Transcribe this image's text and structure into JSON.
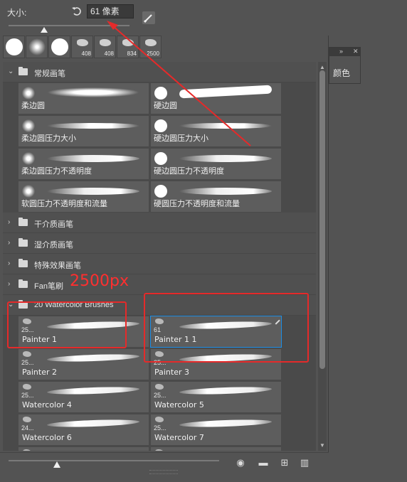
{
  "size_row": {
    "label": "大小:",
    "value": "61 像素"
  },
  "recent_presets": [
    {
      "num": ""
    },
    {
      "num": ""
    },
    {
      "num": ""
    },
    {
      "num": "408"
    },
    {
      "num": "408"
    },
    {
      "num": "834"
    },
    {
      "num": "2500"
    }
  ],
  "groups": {
    "general": {
      "name": "常规画笔"
    },
    "dry": {
      "name": "干介质画笔"
    },
    "wet": {
      "name": "湿介质画笔"
    },
    "special": {
      "name": "特殊效果画笔"
    },
    "fan": {
      "name": "Fan笔刷"
    },
    "watercolor": {
      "name": "20 Watercolor Brushes"
    }
  },
  "general_brushes": [
    {
      "name": "柔边圆"
    },
    {
      "name": "硬边圆"
    },
    {
      "name": "柔边圆压力大小"
    },
    {
      "name": "硬边圆压力大小"
    },
    {
      "name": "柔边圆压力不透明度"
    },
    {
      "name": "硬边圆压力不透明度"
    },
    {
      "name": "软圆压力不透明度和流量"
    },
    {
      "name": "硬圆压力不透明度和流量"
    }
  ],
  "watercolor_brushes": [
    {
      "name": "Painter 1",
      "num": "25..."
    },
    {
      "name": "Painter 1 1",
      "num": "61"
    },
    {
      "name": "Painter 2",
      "num": "25..."
    },
    {
      "name": "Painter 3",
      "num": "25..."
    },
    {
      "name": "Watercolor 4",
      "num": "25..."
    },
    {
      "name": "Watercolor 5",
      "num": "25..."
    },
    {
      "name": "Watercolor 6",
      "num": "24..."
    },
    {
      "name": "Watercolor 7",
      "num": "25..."
    }
  ],
  "annotation": {
    "text": "2500px"
  },
  "color_panel": {
    "label": "颜色"
  },
  "colors": {
    "panel_bg": "#535353",
    "selection": "#1c8ee6",
    "annotation": "#e52a2a"
  }
}
